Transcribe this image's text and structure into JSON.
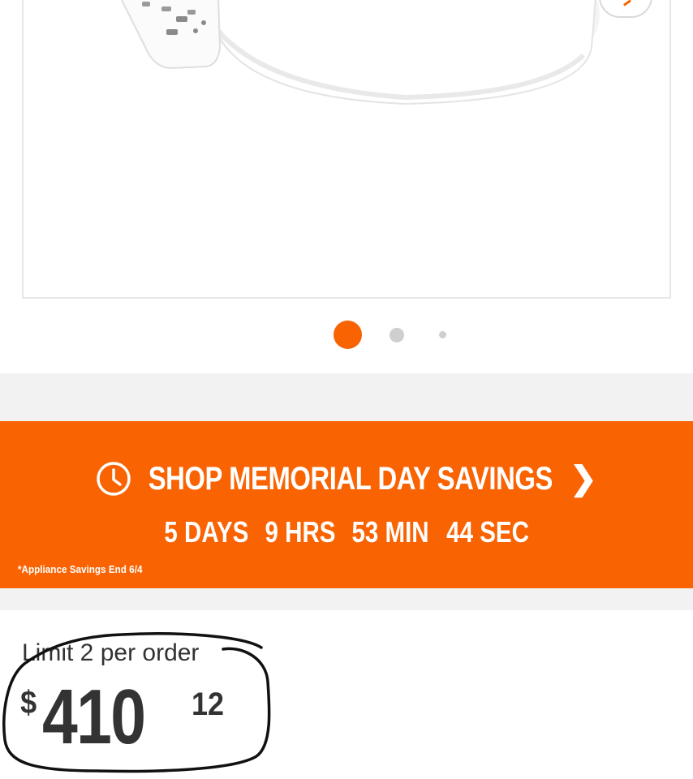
{
  "carousel": {
    "count": 3,
    "active_index": 0
  },
  "promo": {
    "title": "SHOP MEMORIAL DAY SAVINGS",
    "chevron": "❯",
    "countdown": [
      "5 DAYS",
      "9 HRS",
      "53 MIN",
      "44 SEC"
    ],
    "note": "*Appliance Savings End 6/4",
    "icon": "clock-icon"
  },
  "price": {
    "limit": "Limit 2 per order",
    "currency": "$",
    "whole": "410",
    "cents": "12"
  },
  "colors": {
    "brand_orange": "#f96302",
    "text_dark": "#333333",
    "background_grey": "#f2f2f2"
  }
}
